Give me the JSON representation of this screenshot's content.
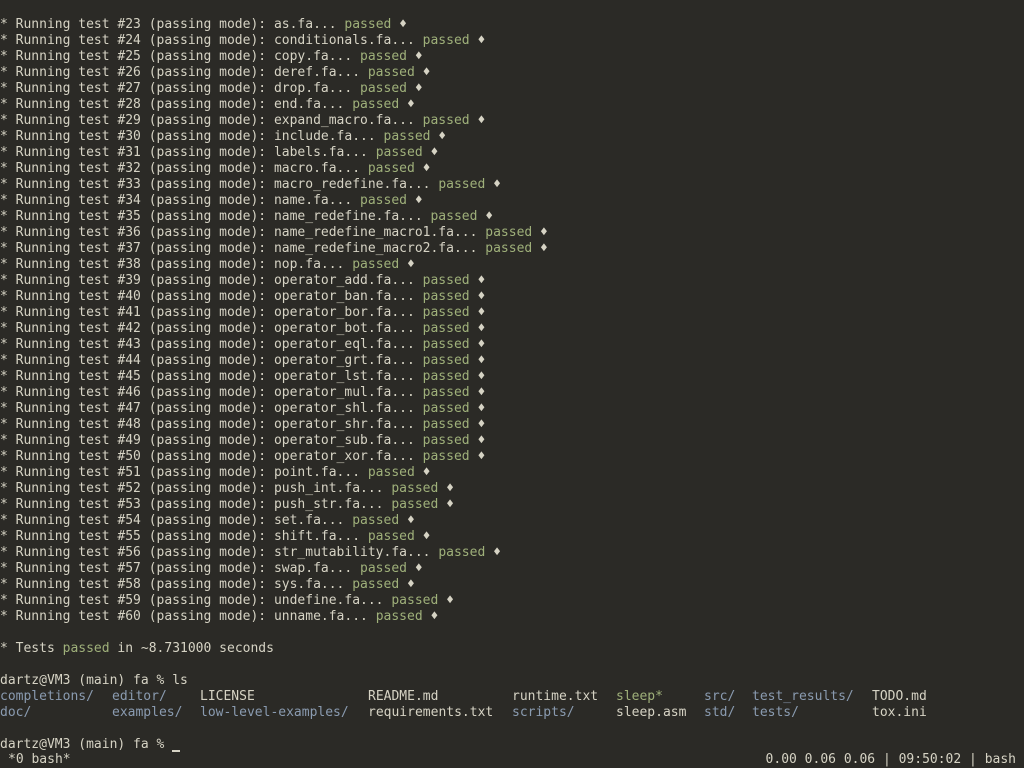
{
  "tests": [
    {
      "prefix": "* Running test #23 (passing mode): ",
      "file": "as.fa...",
      "result": "passed",
      "mark": "♦"
    },
    {
      "prefix": "* Running test #24 (passing mode): ",
      "file": "conditionals.fa...",
      "result": "passed",
      "mark": "♦"
    },
    {
      "prefix": "* Running test #25 (passing mode): ",
      "file": "copy.fa...",
      "result": "passed",
      "mark": "♦"
    },
    {
      "prefix": "* Running test #26 (passing mode): ",
      "file": "deref.fa...",
      "result": "passed",
      "mark": "♦"
    },
    {
      "prefix": "* Running test #27 (passing mode): ",
      "file": "drop.fa...",
      "result": "passed",
      "mark": "♦"
    },
    {
      "prefix": "* Running test #28 (passing mode): ",
      "file": "end.fa...",
      "result": "passed",
      "mark": "♦"
    },
    {
      "prefix": "* Running test #29 (passing mode): ",
      "file": "expand_macro.fa...",
      "result": "passed",
      "mark": "♦"
    },
    {
      "prefix": "* Running test #30 (passing mode): ",
      "file": "include.fa...",
      "result": "passed",
      "mark": "♦"
    },
    {
      "prefix": "* Running test #31 (passing mode): ",
      "file": "labels.fa...",
      "result": "passed",
      "mark": "♦"
    },
    {
      "prefix": "* Running test #32 (passing mode): ",
      "file": "macro.fa...",
      "result": "passed",
      "mark": "♦"
    },
    {
      "prefix": "* Running test #33 (passing mode): ",
      "file": "macro_redefine.fa...",
      "result": "passed",
      "mark": "♦"
    },
    {
      "prefix": "* Running test #34 (passing mode): ",
      "file": "name.fa...",
      "result": "passed",
      "mark": "♦"
    },
    {
      "prefix": "* Running test #35 (passing mode): ",
      "file": "name_redefine.fa...",
      "result": "passed",
      "mark": "♦"
    },
    {
      "prefix": "* Running test #36 (passing mode): ",
      "file": "name_redefine_macro1.fa...",
      "result": "passed",
      "mark": "♦"
    },
    {
      "prefix": "* Running test #37 (passing mode): ",
      "file": "name_redefine_macro2.fa...",
      "result": "passed",
      "mark": "♦"
    },
    {
      "prefix": "* Running test #38 (passing mode): ",
      "file": "nop.fa...",
      "result": "passed",
      "mark": "♦"
    },
    {
      "prefix": "* Running test #39 (passing mode): ",
      "file": "operator_add.fa...",
      "result": "passed",
      "mark": "♦"
    },
    {
      "prefix": "* Running test #40 (passing mode): ",
      "file": "operator_ban.fa...",
      "result": "passed",
      "mark": "♦"
    },
    {
      "prefix": "* Running test #41 (passing mode): ",
      "file": "operator_bor.fa...",
      "result": "passed",
      "mark": "♦"
    },
    {
      "prefix": "* Running test #42 (passing mode): ",
      "file": "operator_bot.fa...",
      "result": "passed",
      "mark": "♦"
    },
    {
      "prefix": "* Running test #43 (passing mode): ",
      "file": "operator_eql.fa...",
      "result": "passed",
      "mark": "♦"
    },
    {
      "prefix": "* Running test #44 (passing mode): ",
      "file": "operator_grt.fa...",
      "result": "passed",
      "mark": "♦"
    },
    {
      "prefix": "* Running test #45 (passing mode): ",
      "file": "operator_lst.fa...",
      "result": "passed",
      "mark": "♦"
    },
    {
      "prefix": "* Running test #46 (passing mode): ",
      "file": "operator_mul.fa...",
      "result": "passed",
      "mark": "♦"
    },
    {
      "prefix": "* Running test #47 (passing mode): ",
      "file": "operator_shl.fa...",
      "result": "passed",
      "mark": "♦"
    },
    {
      "prefix": "* Running test #48 (passing mode): ",
      "file": "operator_shr.fa...",
      "result": "passed",
      "mark": "♦"
    },
    {
      "prefix": "* Running test #49 (passing mode): ",
      "file": "operator_sub.fa...",
      "result": "passed",
      "mark": "♦"
    },
    {
      "prefix": "* Running test #50 (passing mode): ",
      "file": "operator_xor.fa...",
      "result": "passed",
      "mark": "♦"
    },
    {
      "prefix": "* Running test #51 (passing mode): ",
      "file": "point.fa...",
      "result": "passed",
      "mark": "♦"
    },
    {
      "prefix": "* Running test #52 (passing mode): ",
      "file": "push_int.fa...",
      "result": "passed",
      "mark": "♦"
    },
    {
      "prefix": "* Running test #53 (passing mode): ",
      "file": "push_str.fa...",
      "result": "passed",
      "mark": "♦"
    },
    {
      "prefix": "* Running test #54 (passing mode): ",
      "file": "set.fa...",
      "result": "passed",
      "mark": "♦"
    },
    {
      "prefix": "* Running test #55 (passing mode): ",
      "file": "shift.fa...",
      "result": "passed",
      "mark": "♦"
    },
    {
      "prefix": "* Running test #56 (passing mode): ",
      "file": "str_mutability.fa...",
      "result": "passed",
      "mark": "♦"
    },
    {
      "prefix": "* Running test #57 (passing mode): ",
      "file": "swap.fa...",
      "result": "passed",
      "mark": "♦"
    },
    {
      "prefix": "* Running test #58 (passing mode): ",
      "file": "sys.fa...",
      "result": "passed",
      "mark": "♦"
    },
    {
      "prefix": "* Running test #59 (passing mode): ",
      "file": "undefine.fa...",
      "result": "passed",
      "mark": "♦"
    },
    {
      "prefix": "* Running test #60 (passing mode): ",
      "file": "unname.fa...",
      "result": "passed",
      "mark": "♦"
    }
  ],
  "summary": {
    "prefix": "* Tests ",
    "status": "passed",
    "rest": " in ~8.731000 seconds"
  },
  "prompt1": {
    "text": "dartz@VM3 (main) fa % ",
    "command": "ls"
  },
  "ls_rows": [
    [
      {
        "name": "completions/",
        "kind": "dir"
      },
      {
        "name": "editor/",
        "kind": "dir"
      },
      {
        "name": "LICENSE",
        "kind": "file"
      },
      {
        "name": "README.md",
        "kind": "file"
      },
      {
        "name": "runtime.txt",
        "kind": "file"
      },
      {
        "name": "sleep*",
        "kind": "exec"
      },
      {
        "name": "src/",
        "kind": "dir"
      },
      {
        "name": "test_results/",
        "kind": "dir"
      },
      {
        "name": "TODO.md",
        "kind": "file"
      }
    ],
    [
      {
        "name": "doc/",
        "kind": "dir"
      },
      {
        "name": "examples/",
        "kind": "dir"
      },
      {
        "name": "low-level-examples/",
        "kind": "dir"
      },
      {
        "name": "requirements.txt",
        "kind": "file"
      },
      {
        "name": "scripts/",
        "kind": "dir"
      },
      {
        "name": "sleep.asm",
        "kind": "file"
      },
      {
        "name": "std/",
        "kind": "dir"
      },
      {
        "name": "tests/",
        "kind": "dir"
      },
      {
        "name": "tox.ini",
        "kind": "file"
      }
    ]
  ],
  "prompt2": {
    "text": "dartz@VM3 (main) fa % "
  },
  "statusbar": {
    "left": "*0 bash*",
    "right": "0.00 0.06 0.06 | 09:50:02 | bash"
  },
  "colors": {
    "background": "#2b2a26",
    "foreground": "#d6d3c4",
    "passed": "#9fb07a",
    "directory": "#8a9bb0",
    "executable": "#9fb07a"
  }
}
